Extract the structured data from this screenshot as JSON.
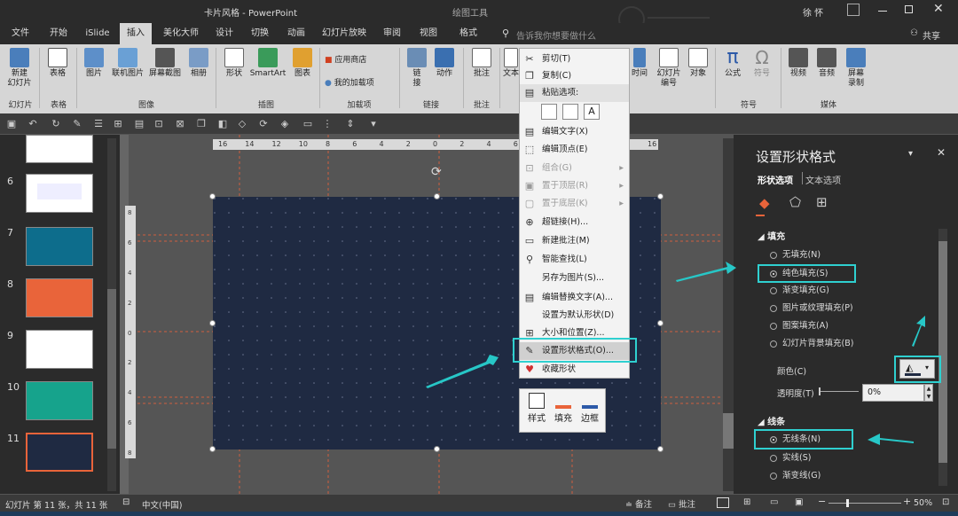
{
  "window": {
    "title": "卡片风格 - PowerPoint",
    "contextual": "绘图工具",
    "user": "徐 怀",
    "share": "共享",
    "tell_me": "告诉我你想要做什么"
  },
  "tabs": [
    "文件",
    "开始",
    "iSlide",
    "插入",
    "美化大师",
    "设计",
    "切换",
    "动画",
    "幻灯片放映",
    "审阅",
    "视图",
    "格式"
  ],
  "active_tab": "插入",
  "ribbon": {
    "items": [
      {
        "label": "新建\n幻灯片",
        "name": "new-slide"
      },
      {
        "label": "表格",
        "name": "table"
      },
      {
        "label": "图片",
        "name": "picture"
      },
      {
        "label": "联机图片",
        "name": "online-picture"
      },
      {
        "label": "屏幕截图",
        "name": "screenshot"
      },
      {
        "label": "相册",
        "name": "album"
      },
      {
        "label": "形状",
        "name": "shapes"
      },
      {
        "label": "SmartArt",
        "name": "smartart"
      },
      {
        "label": "图表",
        "name": "chart"
      },
      {
        "label": "应用商店",
        "name": "store"
      },
      {
        "label": "我的加载项",
        "name": "my-addins"
      },
      {
        "label": "链\n接",
        "name": "link"
      },
      {
        "label": "动作",
        "name": "action"
      },
      {
        "label": "批注",
        "name": "comment"
      },
      {
        "label": "文本",
        "name": "text"
      },
      {
        "label": "时间",
        "name": "time"
      },
      {
        "label": "幻灯片\n编号",
        "name": "slide-number"
      },
      {
        "label": "对象",
        "name": "object"
      },
      {
        "label": "公式",
        "name": "formula"
      },
      {
        "label": "符号",
        "name": "symbol"
      },
      {
        "label": "视频",
        "name": "video"
      },
      {
        "label": "音频",
        "name": "audio"
      },
      {
        "label": "屏幕\n录制",
        "name": "screen-record"
      }
    ],
    "groups": [
      "幻灯片",
      "表格",
      "图像",
      "插图",
      "加载项",
      "链接",
      "批注",
      "符号",
      "媒体"
    ]
  },
  "thumbs": {
    "numbers": [
      "6",
      "7",
      "8",
      "9",
      "10",
      "11"
    ]
  },
  "context_menu": {
    "items": [
      {
        "label": "剪切(T)",
        "icon": "scissors-icon",
        "enabled": true
      },
      {
        "label": "复制(C)",
        "icon": "copy-icon",
        "enabled": true
      },
      {
        "label": "粘贴选项:",
        "icon": "paste-icon",
        "enabled": true
      },
      {
        "label": "编辑文字(X)",
        "icon": "text-icon",
        "enabled": true
      },
      {
        "label": "编辑顶点(E)",
        "icon": "vertex-icon",
        "enabled": true
      },
      {
        "label": "组合(G)",
        "icon": "group-icon",
        "enabled": false
      },
      {
        "label": "置于顶层(R)",
        "icon": "front-icon",
        "enabled": false
      },
      {
        "label": "置于底层(K)",
        "icon": "back-icon",
        "enabled": false
      },
      {
        "label": "超链接(H)...",
        "icon": "link-icon",
        "enabled": true
      },
      {
        "label": "新建批注(M)",
        "icon": "comment-icon",
        "enabled": true
      },
      {
        "label": "智能查找(L)",
        "icon": "search-icon",
        "enabled": true
      },
      {
        "label": "另存为图片(S)...",
        "icon": "",
        "enabled": true
      },
      {
        "label": "编辑替换文字(A)...",
        "icon": "alt-text-icon",
        "enabled": true
      },
      {
        "label": "设置为默认形状(D)",
        "icon": "",
        "enabled": true
      },
      {
        "label": "大小和位置(Z)...",
        "icon": "size-icon",
        "enabled": true
      },
      {
        "label": "设置形状格式(O)...",
        "icon": "format-shape-icon",
        "enabled": true
      },
      {
        "label": "收藏形状",
        "icon": "heart-icon",
        "enabled": true
      }
    ]
  },
  "mini_toolbar": {
    "style": "样式",
    "fill": "填充",
    "outline": "边框"
  },
  "pane": {
    "title": "设置形状格式",
    "tab_shape": "形状选项",
    "tab_text": "文本选项",
    "fill_header": "填充",
    "fill_options": [
      "无填充(N)",
      "纯色填充(S)",
      "渐变填充(G)",
      "图片或纹理填充(P)",
      "图案填充(A)",
      "幻灯片背景填充(B)"
    ],
    "fill_selected": 1,
    "color_label": "颜色(C)",
    "transparency_label": "透明度(T)",
    "transparency_value": "0%",
    "line_header": "线条",
    "line_options": [
      "无线条(N)",
      "实线(S)",
      "渐变线(G)"
    ],
    "line_selected": 0
  },
  "status": {
    "slide": "幻灯片 第 11 张，共 11 张",
    "lang": "中文(中国)",
    "notes": "备注",
    "comments": "批注",
    "zoom": "50%"
  },
  "ruler": {
    "h_labels": [
      "16",
      "14",
      "12",
      "10",
      "8",
      "6",
      "4",
      "2",
      "0",
      "2",
      "4",
      "6",
      "8",
      "10",
      "12",
      "14",
      "16"
    ],
    "v_labels": [
      "8",
      "6",
      "4",
      "2",
      "0",
      "2",
      "4",
      "6",
      "8"
    ]
  },
  "colors": {
    "accent": "#2fd0d0",
    "slide_bg": "#1f2a42",
    "ribbon": "#d6d6d6",
    "dark": "#2b2b2b"
  }
}
